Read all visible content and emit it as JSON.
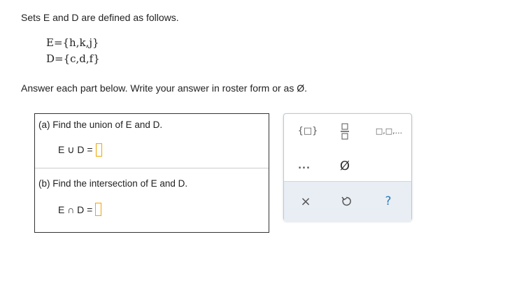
{
  "intro": {
    "text": "Sets E and D are defined as follows."
  },
  "sets": {
    "e_line": "E={h,k,j}",
    "d_line": "D={c,d,f}"
  },
  "instruction": "Answer each part below. Write your answer in roster form or as Ø.",
  "part_a": {
    "label": "(a) Find the union of E and D.",
    "expression": "E ∪ D ="
  },
  "part_b": {
    "label": "(b) Find the intersection of E and D.",
    "expression": "E ∩ D ="
  },
  "toolbar": {
    "set_braces_icon": "{□}",
    "fraction_icon": "fraction",
    "list_icon": "□,□,...",
    "ellipsis_icon": "...",
    "empty_set_icon": "Ø",
    "clear_icon": "×",
    "undo_icon": "undo",
    "help_icon": "?"
  },
  "colors": {
    "answer_box": "#f0a500",
    "toolbar_border": "#b9c8d8",
    "toolbar_bottom": "#e8eef4",
    "help": "#2a7ab8"
  }
}
